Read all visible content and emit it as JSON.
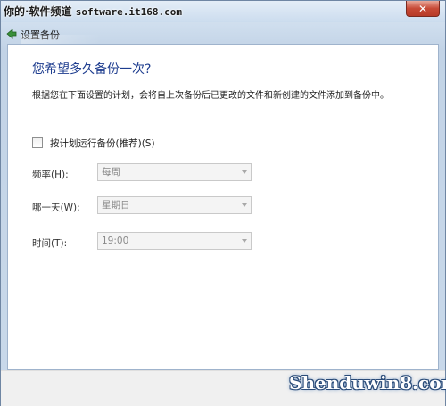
{
  "titlebar": {
    "watermark_prefix": "你的·软件频道",
    "watermark_site": "software.it168.com",
    "close_label": "✕"
  },
  "nav": {
    "title": "设置备份"
  },
  "main": {
    "heading": "您希望多久备份一次?",
    "description": "根据您在下面设置的计划，会将自上次备份后已更改的文件和新创建的文件添加到备份中。",
    "schedule_checkbox_label": "按计划运行备份(推荐)(S)",
    "schedule_checked": false,
    "fields": [
      {
        "label": "频率(H):",
        "value": "每周"
      },
      {
        "label": "哪一天(W):",
        "value": "星期日"
      },
      {
        "label": "时间(T):",
        "value": "19:00"
      }
    ]
  },
  "watermark_bottom": "Shenduwin8.com",
  "colors": {
    "heading": "#1e3d8f",
    "close_button": "#c74a36",
    "window_frame": "#c9d9ea"
  }
}
